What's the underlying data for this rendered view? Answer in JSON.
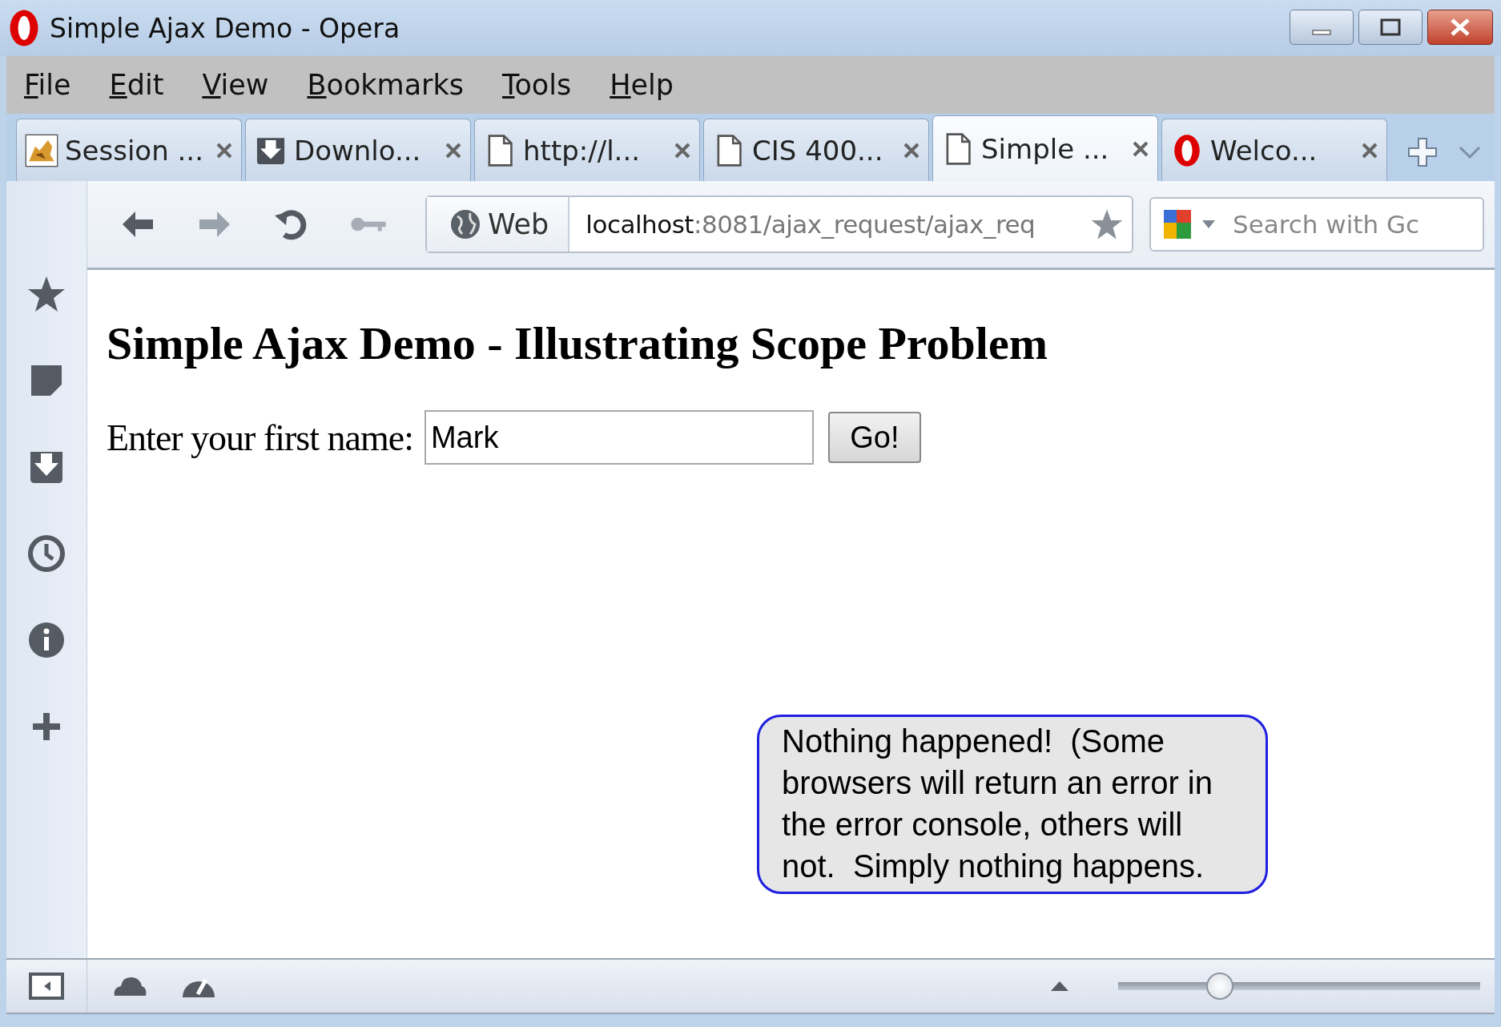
{
  "window": {
    "title": "Simple Ajax Demo - Opera"
  },
  "menu": [
    "File",
    "Edit",
    "View",
    "Bookmarks",
    "Tools",
    "Help"
  ],
  "tabs": [
    {
      "label": "Session ...",
      "selected": false
    },
    {
      "label": "Downlo...",
      "selected": false
    },
    {
      "label": "http://l...",
      "selected": false
    },
    {
      "label": "CIS 400...",
      "selected": false
    },
    {
      "label": "Simple ...",
      "selected": true
    },
    {
      "label": "Welco...",
      "selected": false
    }
  ],
  "toolbar": {
    "web_label": "Web",
    "url_host": "localhost",
    "url_path": ":8081/ajax_request/ajax_req",
    "search_placeholder": "Search with Gc"
  },
  "page": {
    "heading": "Simple Ajax Demo - Illustrating Scope Problem",
    "label": "Enter your first name:",
    "name_value": "Mark",
    "button": "Go!"
  },
  "callout": "Nothing happened!  (Some browsers will return an error in the error console, others will not.  Simply nothing happens.",
  "status_bar": {
    "zoom": {
      "level": 0.28
    }
  }
}
